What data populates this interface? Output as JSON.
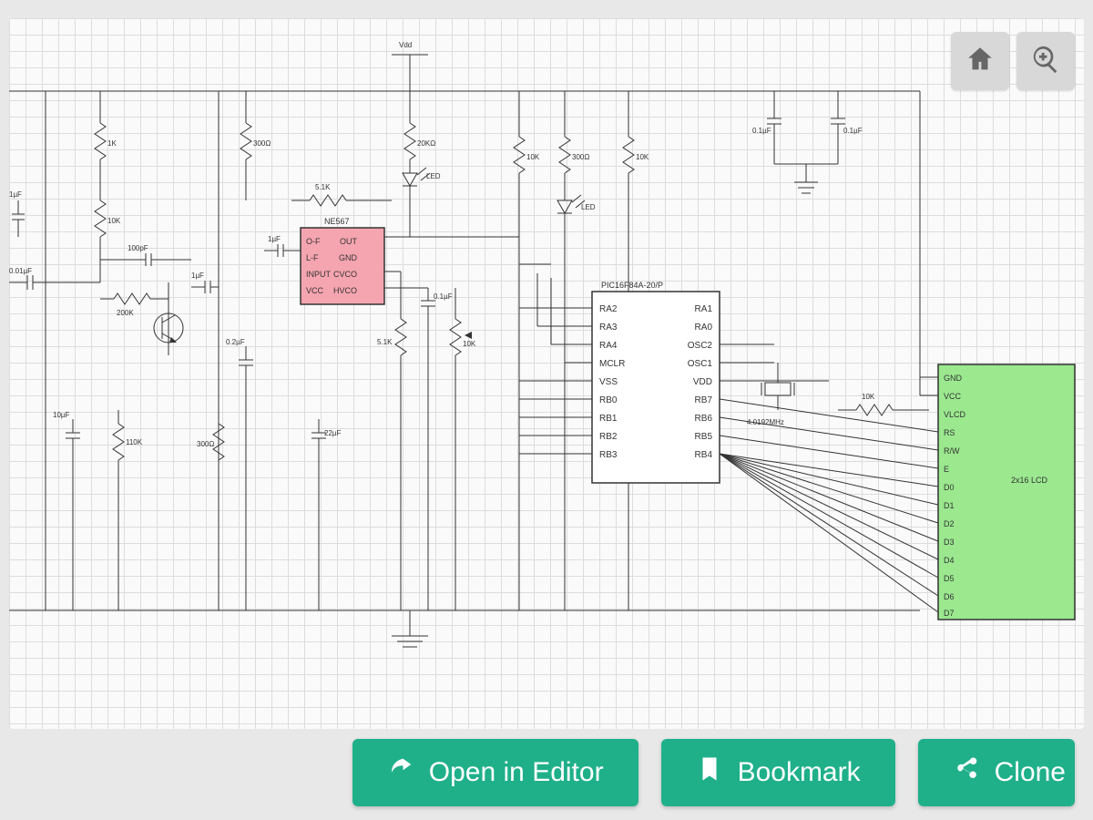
{
  "rail": {
    "vdd": "Vdd"
  },
  "toolbar": {
    "open_label": "Open in Editor",
    "bookmark_label": "Bookmark",
    "clone_label": "Clone"
  },
  "controls": {
    "home_tip": "Home",
    "zoom_tip": "Zoom"
  },
  "ic_tone": {
    "name": "NE567",
    "pins_left": [
      "O-F",
      "L-F",
      "INPUT",
      "VCC"
    ],
    "pins_right": [
      "OUT",
      "GND",
      "CVCO",
      "HVCO"
    ]
  },
  "ic_pic": {
    "name": "PIC16F84A-20/P",
    "pins_left": [
      "RA2",
      "RA3",
      "RA4",
      "MCLR",
      "VSS",
      "RB0",
      "RB1",
      "RB2",
      "RB3"
    ],
    "pins_right": [
      "RA1",
      "RA0",
      "OSC2",
      "OSC1",
      "VDD",
      "RB7",
      "RB6",
      "RB5",
      "RB4"
    ]
  },
  "lcd": {
    "name": "2x16 LCD",
    "pins": [
      "GND",
      "VCC",
      "VLCD",
      "RS",
      "R/W",
      "E",
      "D0",
      "D1",
      "D2",
      "D3",
      "D4",
      "D5",
      "D6",
      "D7"
    ]
  },
  "parts": {
    "r1k": "1K",
    "r10k": "10K",
    "r110k": "110K",
    "r200k": "200K",
    "r300a": "300Ω",
    "r300b": "300Ω",
    "r5_1k": "5.1K",
    "r20k": "20KΩ",
    "c1uf": "1µF",
    "c0_01uf": "0.01µF",
    "c0_1uf": "0.1µF",
    "c0_1uf_b": "0.1µF",
    "c0_1uf_c": "0.1µF",
    "c10uf": "10µF",
    "c100pf": "100pF",
    "c0_2uf": "0.2µF",
    "c22uf": "22µF",
    "led1": "LED",
    "led2": "LED",
    "xtal": "4.0192MHz"
  }
}
